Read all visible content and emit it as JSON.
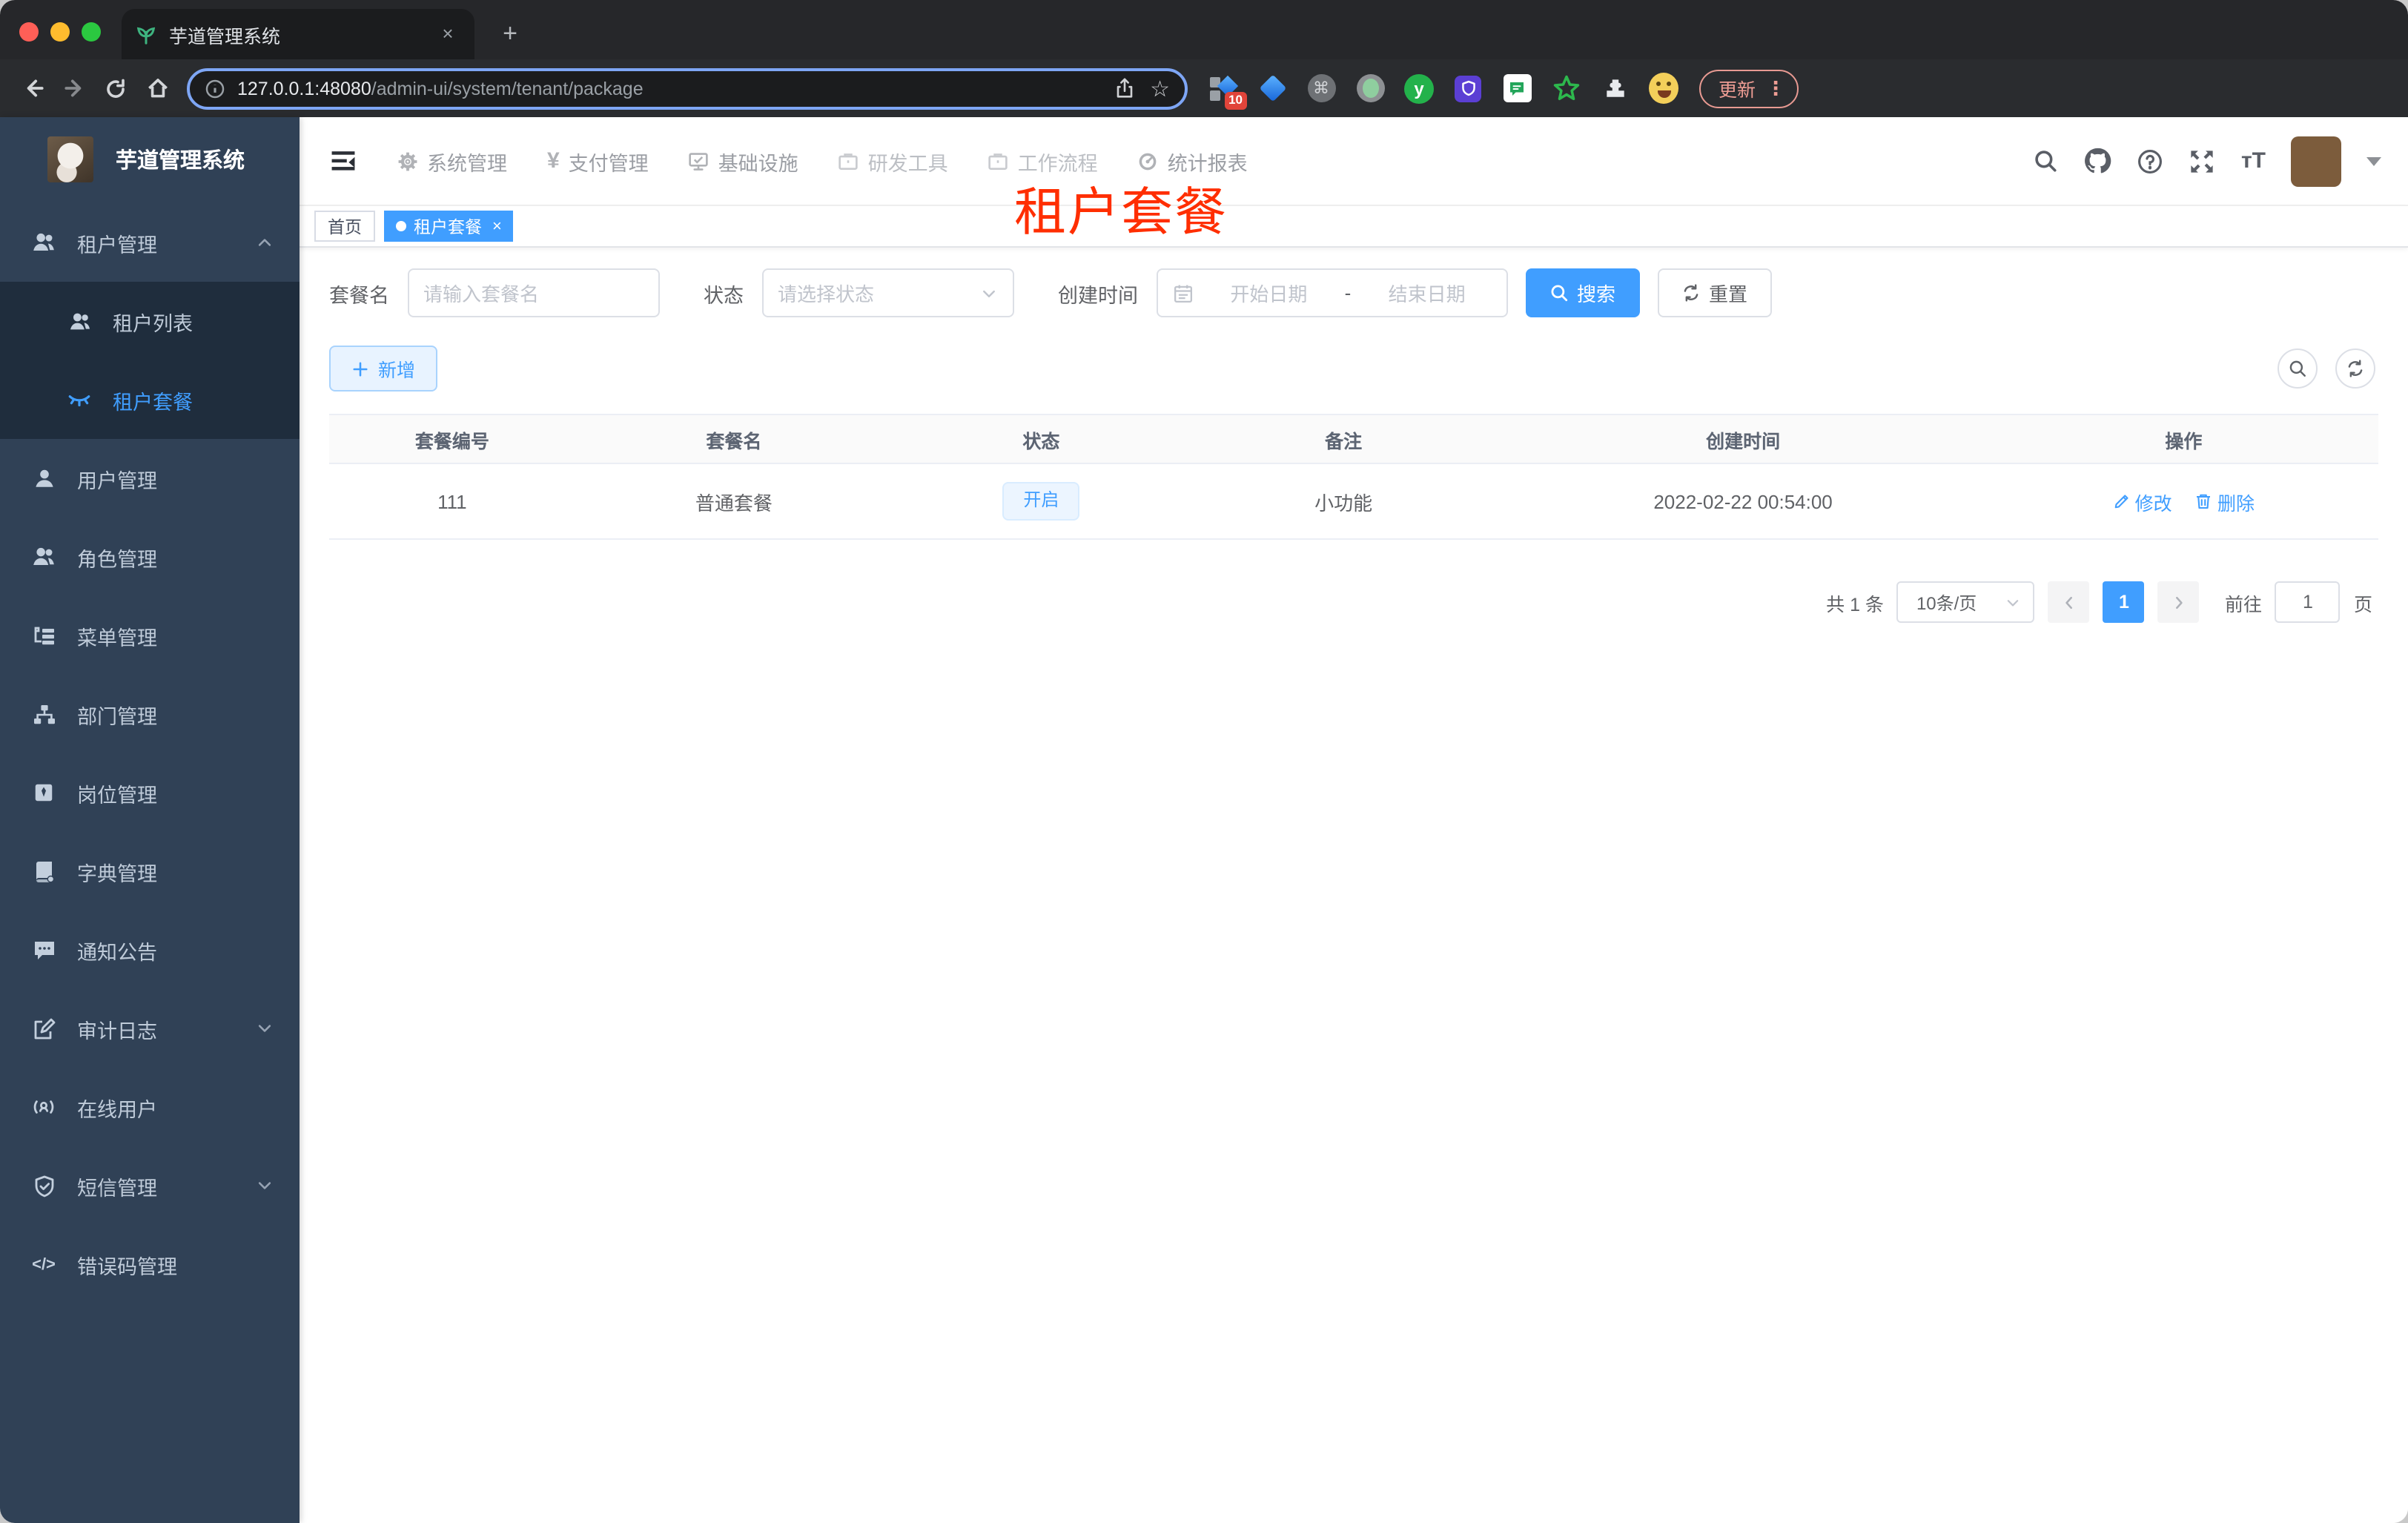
{
  "browser": {
    "tab_title": "芋道管理系统",
    "tab_close": "×",
    "new_tab": "+",
    "url_host": "127.0.0.1:48080",
    "url_path": "/admin-ui/system/tenant/package",
    "extension_badge": "10",
    "update_label": "更新",
    "menu_dots": "⋮"
  },
  "icons": {
    "star": "☆",
    "command": "⌘",
    "code": "</>",
    "yen": "¥",
    "font_size": "тT",
    "ext_y": "y"
  },
  "colors": {
    "accent": "#409eff",
    "sidebar_bg": "#304156",
    "submenu_bg": "#1f2d3d",
    "annotation_red": "#ff2e00",
    "tag_active_bg": "#409eff"
  },
  "sidebar": {
    "logo_title": "芋道管理系统",
    "items": [
      {
        "label": "租户管理"
      },
      {
        "label": "租户列表"
      },
      {
        "label": "租户套餐"
      },
      {
        "label": "用户管理"
      },
      {
        "label": "角色管理"
      },
      {
        "label": "菜单管理"
      },
      {
        "label": "部门管理"
      },
      {
        "label": "岗位管理"
      },
      {
        "label": "字典管理"
      },
      {
        "label": "通知公告"
      },
      {
        "label": "审计日志"
      },
      {
        "label": "在线用户"
      },
      {
        "label": "短信管理"
      },
      {
        "label": "错误码管理"
      }
    ]
  },
  "topnav": {
    "items": [
      {
        "label": "系统管理"
      },
      {
        "label": "支付管理"
      },
      {
        "label": "基础设施"
      },
      {
        "label": "研发工具"
      },
      {
        "label": "工作流程"
      },
      {
        "label": "统计报表"
      }
    ]
  },
  "tags": {
    "home": "首页",
    "active": "租户套餐",
    "close": "×"
  },
  "overlay_title": "租户套餐",
  "filters": {
    "name_label": "套餐名",
    "name_placeholder": "请输入套餐名",
    "status_label": "状态",
    "status_placeholder": "请选择状态",
    "time_label": "创建时间",
    "start_placeholder": "开始日期",
    "range_separator": "-",
    "end_placeholder": "结束日期",
    "search_label": "搜索",
    "reset_label": "重置"
  },
  "toolbar": {
    "add_label": "新增"
  },
  "table": {
    "headers": [
      "套餐编号",
      "套餐名",
      "状态",
      "备注",
      "创建时间",
      "操作"
    ],
    "rows": [
      {
        "id": "111",
        "name": "普通套餐",
        "status": "开启",
        "remark": "小功能",
        "create_time": "2022-02-22 00:54:00",
        "edit_label": "修改",
        "delete_label": "删除"
      }
    ]
  },
  "pagination": {
    "total": "共 1 条",
    "page_size": "10条/页",
    "current_page": "1",
    "goto_label": "前往",
    "goto_value": "1",
    "page_suffix": "页"
  }
}
